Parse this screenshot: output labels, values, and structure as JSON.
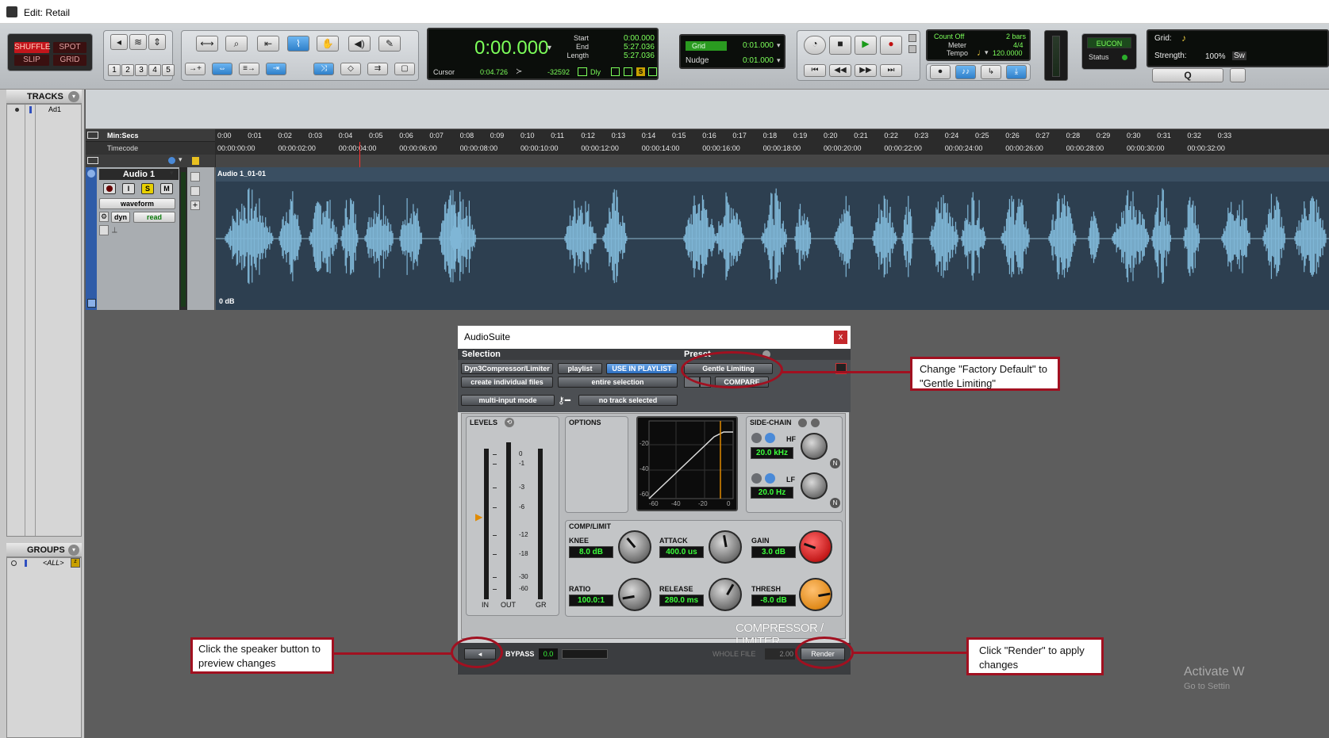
{
  "window": {
    "title": "Edit: Retail"
  },
  "edit_modes": {
    "shuffle": "SHUFFLE",
    "spot": "SPOT",
    "slip": "SLIP",
    "grid": "GRID"
  },
  "zoom_presets": [
    "1",
    "2",
    "3",
    "4",
    "5"
  ],
  "counter": {
    "main": "0:00.000",
    "start_label": "Start",
    "end_label": "End",
    "length_label": "Length",
    "start": "0:00.000",
    "end": "5:27.036",
    "length": "5:27.036",
    "cursor_label": "Cursor",
    "cursor": "0:04.726",
    "sample": "-32592",
    "dly": "Dly"
  },
  "grid_nudge": {
    "grid_label": "Grid",
    "grid_value": "0:01.000",
    "nudge_label": "Nudge",
    "nudge_value": "0:01.000"
  },
  "meter": {
    "count_off": "Count Off",
    "bars": "2 bars",
    "meter_label": "Meter",
    "meter_value": "4/4",
    "tempo_label": "Tempo",
    "tempo_value": "120.0000"
  },
  "eucon": {
    "label": "EUCON",
    "status": "Status"
  },
  "grid_strength": {
    "grid": "Grid:",
    "strength_label": "Strength:",
    "strength": "100%",
    "swing": "Sw"
  },
  "quantize": "Q",
  "tracks_panel": {
    "title": "TRACKS",
    "item": "Ad1"
  },
  "groups_panel": {
    "title": "GROUPS",
    "item": "<ALL>"
  },
  "ruler": {
    "min_secs": "Min:Secs",
    "timecode": "Timecode",
    "ticks": [
      "0:00",
      "0:01",
      "0:02",
      "0:03",
      "0:04",
      "0:05",
      "0:06",
      "0:07",
      "0:08",
      "0:09",
      "0:10",
      "0:11",
      "0:12",
      "0:13",
      "0:14",
      "0:15",
      "0:16",
      "0:17",
      "0:18",
      "0:19",
      "0:20",
      "0:21",
      "0:22",
      "0:23",
      "0:24",
      "0:25",
      "0:26",
      "0:27",
      "0:28",
      "0:29",
      "0:30",
      "0:31",
      "0:32",
      "0:33"
    ],
    "timecodes": [
      "00:00:00:00",
      "00:00:02:00",
      "00:00:04:00",
      "00:00:06:00",
      "00:00:08:00",
      "00:00:10:00",
      "00:00:12:00",
      "00:00:14:00",
      "00:00:16:00",
      "00:00:18:00",
      "00:00:20:00",
      "00:00:22:00",
      "00:00:24:00",
      "00:00:26:00",
      "00:00:28:00",
      "00:00:30:00",
      "00:00:32:00"
    ]
  },
  "track": {
    "name": "Audio 1",
    "rec": "",
    "input": "I",
    "solo": "S",
    "mute": "M",
    "view": "waveform",
    "dyn": "dyn",
    "automation": "read",
    "clip_name": "Audio 1_01-01",
    "gain": "0 dB"
  },
  "audiosuite": {
    "title": "AudioSuite",
    "close": "x",
    "selection_label": "Selection",
    "preset_label": "Preset",
    "plugin": "Dyn3Compressor/Limiter",
    "playlist": "playlist",
    "use_in_playlist": "USE IN PLAYLIST",
    "preset_value": "Gentle Limiting",
    "create_files": "create individual files",
    "entire_selection": "entire selection",
    "compare": "COMPARE",
    "multi_input": "multi-input mode",
    "no_track": "no track selected",
    "levels_label": "LEVELS",
    "options_label": "OPTIONS",
    "sidechain_label": "SIDE-CHAIN",
    "complimit_label": "COMP/LIMIT",
    "meter_scale": [
      "0",
      "-1",
      "-3",
      "-6",
      "-12",
      "-18",
      "-30",
      "-60"
    ],
    "meter_labels": [
      "IN",
      "OUT",
      "GR"
    ],
    "graph_y": [
      "-20",
      "-40",
      "-60"
    ],
    "graph_x": [
      "-60",
      "-40",
      "-20",
      "0"
    ],
    "hf_label": "HF",
    "hf_value": "20.0 kHz",
    "lf_label": "LF",
    "lf_value": "20.0 Hz",
    "knee_label": "KNEE",
    "knee_value": "8.0 dB",
    "attack_label": "ATTACK",
    "attack_value": "400.0 us",
    "gain_label": "GAIN",
    "gain_value": "3.0 dB",
    "ratio_label": "RATIO",
    "ratio_value": "100.0:1",
    "release_label": "RELEASE",
    "release_value": "280.0 ms",
    "thresh_label": "THRESH",
    "thresh_value": "-8.0 dB",
    "brand": "COMPRESSOR / LIMITER",
    "bypass": "BYPASS",
    "bypass_value": "0.0",
    "whole_file": "WHOLE FILE",
    "whole_file_value": "2.00",
    "render": "Render"
  },
  "callouts": {
    "preset": "Change \"Factory Default\" to \"Gentle Limiting\"",
    "speaker": "Click the speaker button to preview changes",
    "render": "Click \"Render\" to apply changes"
  },
  "watermark": {
    "line1": "Activate W",
    "line2": "Go to Settin"
  },
  "colors": {
    "callout": "#a11020",
    "waveform": "#7fb6d6",
    "track_bg": "#2d3f50",
    "lcd_green": "#7cff5a"
  }
}
